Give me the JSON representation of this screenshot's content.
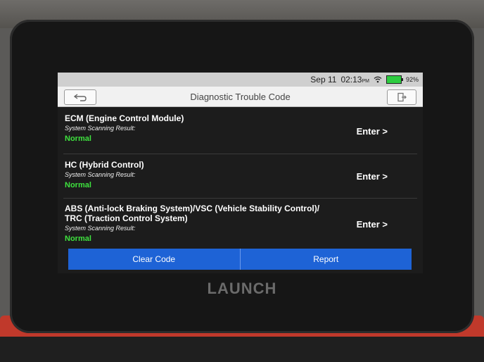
{
  "status_bar": {
    "date": "Sep 11",
    "time": "02:13",
    "ampm": "PM",
    "battery": "92%"
  },
  "header": {
    "title": "Diagnostic Trouble Code"
  },
  "modules": [
    {
      "name": "ECM (Engine Control Module)",
      "result_label": "System Scanning Result:",
      "status": "Normal",
      "action": "Enter >"
    },
    {
      "name": "HC (Hybrid Control)",
      "result_label": "System Scanning Result:",
      "status": "Normal",
      "action": "Enter >"
    },
    {
      "name": "ABS (Anti-lock Braking System)/VSC (Vehicle Stability Control)/",
      "name_line2": "TRC (Traction Control System)",
      "result_label": "System Scanning Result:",
      "status": "Normal",
      "action": "Enter >"
    }
  ],
  "footer": {
    "clear_code": "Clear Code",
    "report": "Report"
  },
  "device": {
    "brand": "LAUNCH"
  },
  "colors": {
    "accent": "#1e63d6",
    "status_normal": "#3ee23e"
  }
}
